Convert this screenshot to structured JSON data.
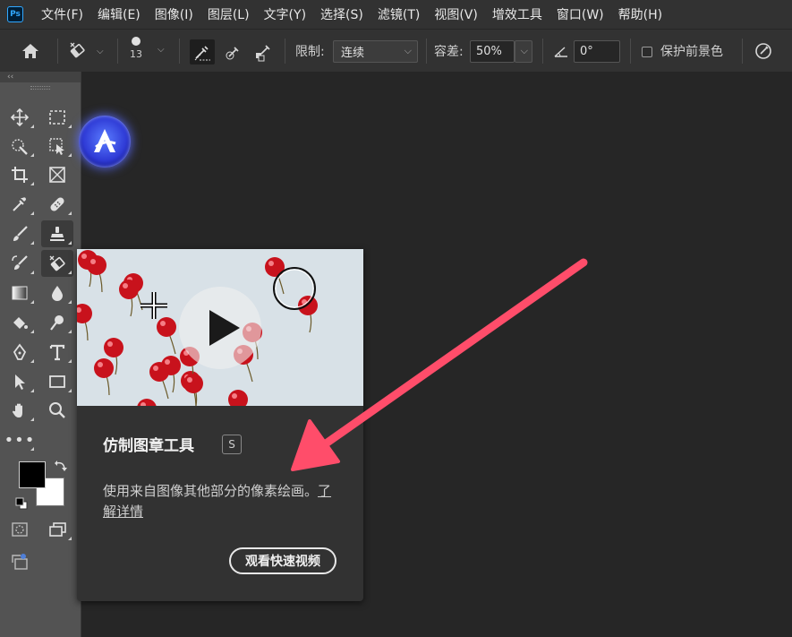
{
  "app": {
    "logo_text": "Ps"
  },
  "menu": [
    "文件(F)",
    "编辑(E)",
    "图像(I)",
    "图层(L)",
    "文字(Y)",
    "选择(S)",
    "滤镜(T)",
    "视图(V)",
    "增效工具",
    "窗口(W)",
    "帮助(H)"
  ],
  "options": {
    "brush_size": "13",
    "limit_label": "限制:",
    "limit_value": "连续",
    "tolerance_label": "容差:",
    "tolerance_value": "50%",
    "angle_value": "0°",
    "protect_fg_label": "保护前景色",
    "protect_fg_checked": false
  },
  "toolbox": {
    "collapse_label": "‹‹"
  },
  "tooltip": {
    "title": "仿制图章工具",
    "shortcut": "S",
    "description": "使用来自图像其他部分的像素绘画。",
    "learn_more": "了解详情",
    "watch_video": "观看快速视频"
  },
  "colors": {
    "foreground": "#000000",
    "background": "#ffffff",
    "arrow": "#ff4d6a",
    "accent": "#31a8ff"
  }
}
